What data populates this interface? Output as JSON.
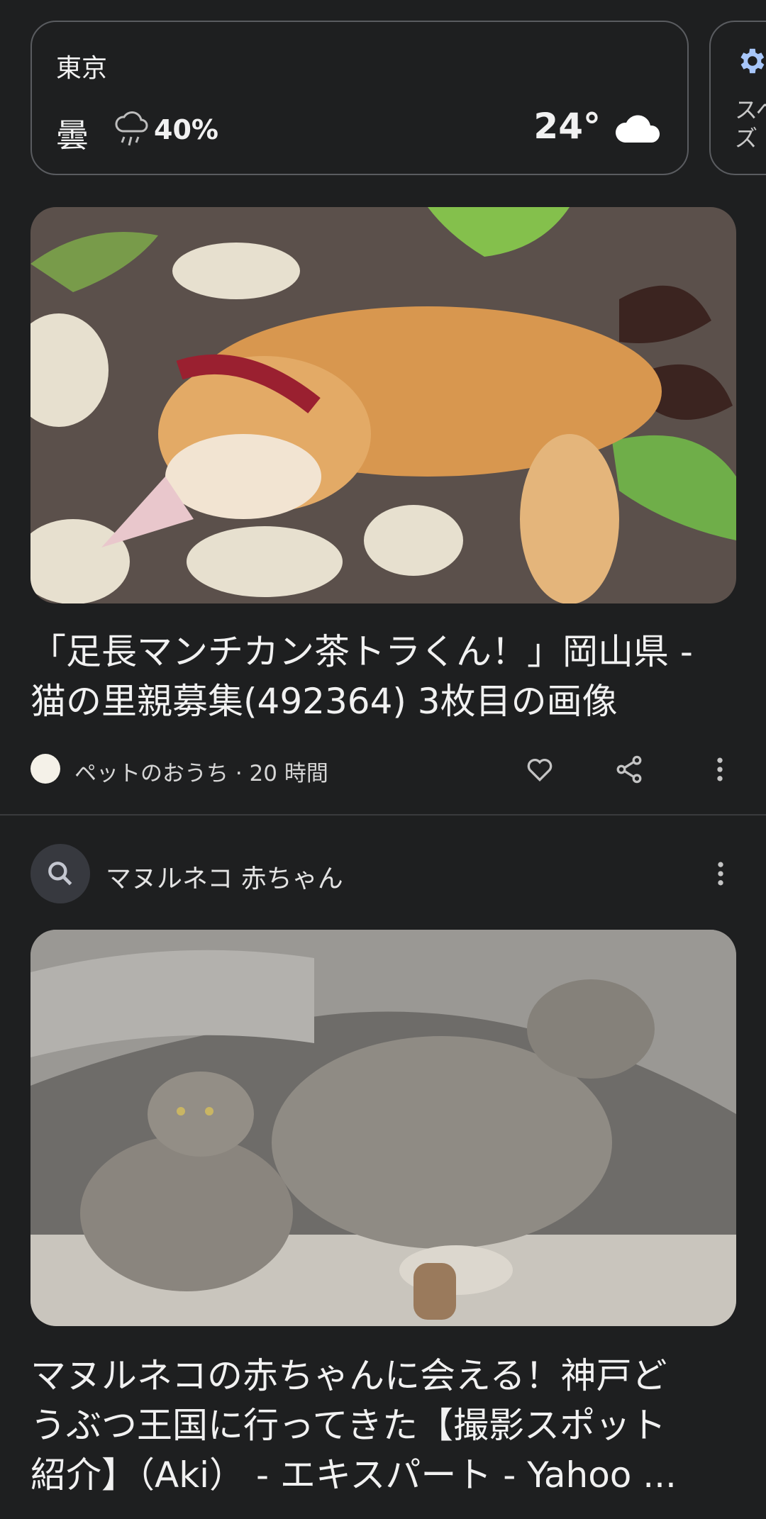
{
  "weather": {
    "city": "東京",
    "condition": "曇",
    "rain_chance": "40%",
    "temperature": "24°",
    "icons": [
      "rain-icon",
      "cloud-icon"
    ]
  },
  "side_card": {
    "icon": "gear-icon",
    "text_line1": "スペ",
    "text_line2": "ズ"
  },
  "articles": [
    {
      "image_description": "orange kitten sleeping on patterned rug",
      "title_line1": "「足長マンチカン茶トラくん！」岡山県 -",
      "title_line2": "猫の里親募集(492364) 3枚目の画像",
      "source": "ペットのおうち · 20 時間",
      "actions": [
        "heart-icon",
        "share-icon",
        "more-vert-icon"
      ]
    }
  ],
  "search_suggestion": {
    "query": "マヌルネコ 赤ちゃん",
    "card_title_line1": "マヌルネコの赤ちゃんに会える！神戸ど",
    "card_title_line2": "うぶつ王国に行ってきた【撮影スポット",
    "card_title_line3": "紹介】（Aki） - エキスパート - Yahoo ..."
  },
  "colors": {
    "background": "#1e1f20",
    "text": "#e3e3e3",
    "accent_gear": "#a8c7fa"
  }
}
